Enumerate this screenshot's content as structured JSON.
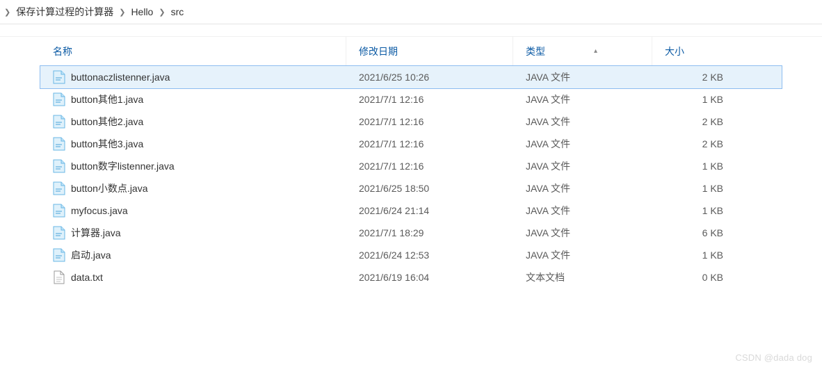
{
  "breadcrumb": {
    "items": [
      "保存计算过程的计算器",
      "Hello",
      "src"
    ]
  },
  "columns": {
    "name": "名称",
    "date": "修改日期",
    "type": "类型",
    "size": "大小",
    "sorted": "type"
  },
  "files": [
    {
      "name": "buttonaczlistenner.java",
      "date": "2021/6/25 10:26",
      "type": "JAVA 文件",
      "size": "2 KB",
      "icon": "java",
      "selected": true
    },
    {
      "name": "button其他1.java",
      "date": "2021/7/1 12:16",
      "type": "JAVA 文件",
      "size": "1 KB",
      "icon": "java",
      "selected": false
    },
    {
      "name": "button其他2.java",
      "date": "2021/7/1 12:16",
      "type": "JAVA 文件",
      "size": "2 KB",
      "icon": "java",
      "selected": false
    },
    {
      "name": "button其他3.java",
      "date": "2021/7/1 12:16",
      "type": "JAVA 文件",
      "size": "2 KB",
      "icon": "java",
      "selected": false
    },
    {
      "name": "button数字listenner.java",
      "date": "2021/7/1 12:16",
      "type": "JAVA 文件",
      "size": "1 KB",
      "icon": "java",
      "selected": false
    },
    {
      "name": "button小数点.java",
      "date": "2021/6/25 18:50",
      "type": "JAVA 文件",
      "size": "1 KB",
      "icon": "java",
      "selected": false
    },
    {
      "name": "myfocus.java",
      "date": "2021/6/24 21:14",
      "type": "JAVA 文件",
      "size": "1 KB",
      "icon": "java",
      "selected": false
    },
    {
      "name": "计算器.java",
      "date": "2021/7/1 18:29",
      "type": "JAVA 文件",
      "size": "6 KB",
      "icon": "java",
      "selected": false
    },
    {
      "name": "启动.java",
      "date": "2021/6/24 12:53",
      "type": "JAVA 文件",
      "size": "1 KB",
      "icon": "java",
      "selected": false
    },
    {
      "name": "data.txt",
      "date": "2021/6/19 16:04",
      "type": "文本文档",
      "size": "0 KB",
      "icon": "txt",
      "selected": false
    }
  ],
  "watermark": "CSDN @dada dog"
}
